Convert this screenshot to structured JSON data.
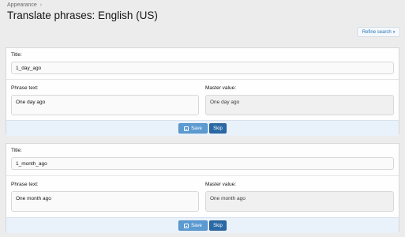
{
  "breadcrumb": {
    "items": [
      "Appearance"
    ],
    "separator": "›"
  },
  "page": {
    "title": "Translate phrases: English (US)"
  },
  "toolbar": {
    "refine_label": "Refine search",
    "refine_caret": "▾"
  },
  "phrases": [
    {
      "title_label": "Title:",
      "title_value": "1_day_ago",
      "phrase_text_label": "Phrase text:",
      "phrase_text_value": "One day ago",
      "master_label": "Master value:",
      "master_value": "One day ago",
      "save_label": "Save",
      "skip_label": "Skip"
    },
    {
      "title_label": "Title:",
      "title_value": "1_month_ago",
      "phrase_text_label": "Phrase text:",
      "phrase_text_value": "One month ago",
      "master_label": "Master value:",
      "master_value": "One month ago",
      "save_label": "Save",
      "skip_label": "Skip"
    }
  ],
  "colors": {
    "save_button": "#5c9ad2",
    "skip_button": "#2a69a6",
    "footer_bg": "#e9f1fa",
    "link": "#2577b1"
  }
}
